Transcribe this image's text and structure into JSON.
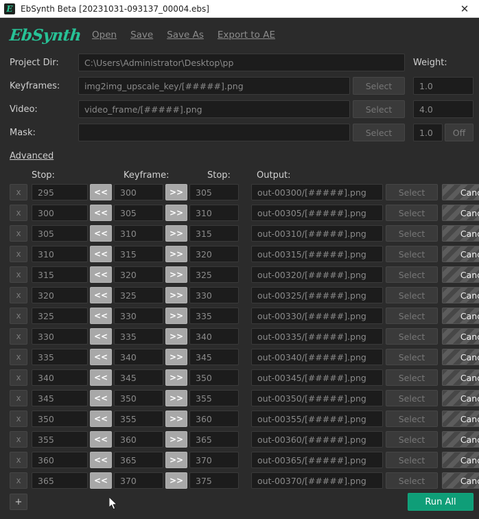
{
  "window": {
    "title": "EbSynth Beta [20231031-093137_00004.ebs]",
    "icon_name": "ebsynth-app-icon",
    "icon_glyph": "E",
    "close_glyph": "✕"
  },
  "header": {
    "logo_text": "EbSynth",
    "menu": [
      {
        "label": "Open"
      },
      {
        "label": "Save"
      },
      {
        "label": "Save As"
      },
      {
        "label": "Export to AE"
      }
    ]
  },
  "form": {
    "project_dir": {
      "label": "Project Dir:",
      "value": "C:\\Users\\Administrator\\Desktop\\pp"
    },
    "keyframes": {
      "label": "Keyframes:",
      "value": "img2img_upscale_key/[#####].png",
      "select_label": "Select",
      "weight": "1.0"
    },
    "video": {
      "label": "Video:",
      "value": "video_frame/[#####].png",
      "select_label": "Select",
      "weight": "4.0"
    },
    "mask": {
      "label": "Mask:",
      "value": "",
      "select_label": "Select",
      "weight": "1.0",
      "toggle_label": "Off"
    },
    "weight_label": "Weight:",
    "advanced_label": "Advanced"
  },
  "table": {
    "headers": {
      "stop_before": "Stop:",
      "keyframe": "Keyframe:",
      "stop_after": "Stop:",
      "output": "Output:"
    },
    "remove_label": "x",
    "prev_label": "<<",
    "next_label": ">>",
    "select_label": "Select",
    "cancel_label": "Cancel",
    "rows": [
      {
        "stop_before": "295",
        "keyframe": "300",
        "stop_after": "305",
        "output": "out-00300/[#####].png"
      },
      {
        "stop_before": "300",
        "keyframe": "305",
        "stop_after": "310",
        "output": "out-00305/[#####].png"
      },
      {
        "stop_before": "305",
        "keyframe": "310",
        "stop_after": "315",
        "output": "out-00310/[#####].png"
      },
      {
        "stop_before": "310",
        "keyframe": "315",
        "stop_after": "320",
        "output": "out-00315/[#####].png"
      },
      {
        "stop_before": "315",
        "keyframe": "320",
        "stop_after": "325",
        "output": "out-00320/[#####].png"
      },
      {
        "stop_before": "320",
        "keyframe": "325",
        "stop_after": "330",
        "output": "out-00325/[#####].png"
      },
      {
        "stop_before": "325",
        "keyframe": "330",
        "stop_after": "335",
        "output": "out-00330/[#####].png"
      },
      {
        "stop_before": "330",
        "keyframe": "335",
        "stop_after": "340",
        "output": "out-00335/[#####].png"
      },
      {
        "stop_before": "335",
        "keyframe": "340",
        "stop_after": "345",
        "output": "out-00340/[#####].png"
      },
      {
        "stop_before": "340",
        "keyframe": "345",
        "stop_after": "350",
        "output": "out-00345/[#####].png"
      },
      {
        "stop_before": "345",
        "keyframe": "350",
        "stop_after": "355",
        "output": "out-00350/[#####].png"
      },
      {
        "stop_before": "350",
        "keyframe": "355",
        "stop_after": "360",
        "output": "out-00355/[#####].png"
      },
      {
        "stop_before": "355",
        "keyframe": "360",
        "stop_after": "365",
        "output": "out-00360/[#####].png"
      },
      {
        "stop_before": "360",
        "keyframe": "365",
        "stop_after": "370",
        "output": "out-00365/[#####].png"
      },
      {
        "stop_before": "365",
        "keyframe": "370",
        "stop_after": "375",
        "output": "out-00370/[#####].png"
      }
    ]
  },
  "footer": {
    "add_label": "+",
    "run_all_label": "Run All"
  },
  "colors": {
    "accent": "#27c196",
    "run_button": "#0f9e78",
    "window_bg": "#2b2b2b",
    "field_bg": "#1c1c1c",
    "arrow_btn": "#a8a8a8"
  }
}
